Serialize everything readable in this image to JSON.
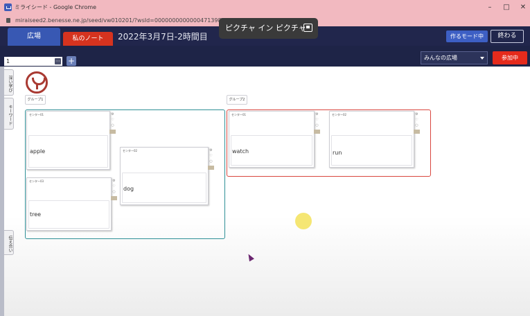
{
  "browser": {
    "window_title": "ミライシード - Google Chrome",
    "url": "miraiseed2.benesse.ne.jp/seed/vw010201/?wsId=0000000000000471398",
    "minimize": "–",
    "maximize": "□",
    "close": "✕"
  },
  "pip_banner": "ピクチャ イン ピクチャ",
  "header": {
    "tab_plaza": "広場",
    "tab_note": "私のノート",
    "lesson_title": "2022年3月7日-2時間目",
    "create_mode": "作るモード中",
    "finish": "終わる"
  },
  "toolbar": {
    "page_value": "1",
    "page_menu": "⋯",
    "add_page": "+",
    "plaza_select": "みんなの広場",
    "join": "参加中"
  },
  "side_tabs": {
    "deep_learning": "深い学び",
    "keyword": "キーワード",
    "share": "伝え合い"
  },
  "groups": [
    {
      "tag": "グループ1",
      "border_color": "#2e8f96"
    },
    {
      "tag": "グループ2",
      "border_color": "#d9463e"
    }
  ],
  "cards": [
    {
      "header": "センター01",
      "word": "apple"
    },
    {
      "header": "センター02",
      "word": "dog"
    },
    {
      "header": "センター03",
      "word": "tree"
    },
    {
      "header": "センター01",
      "word": "watch"
    },
    {
      "header": "センター02",
      "word": "run"
    }
  ],
  "colors": {
    "header_bg": "#21264c",
    "tab_plaza": "#3858b3",
    "tab_note": "#d6331f",
    "join_btn": "#e52b1c",
    "logo": "#a93a32"
  }
}
